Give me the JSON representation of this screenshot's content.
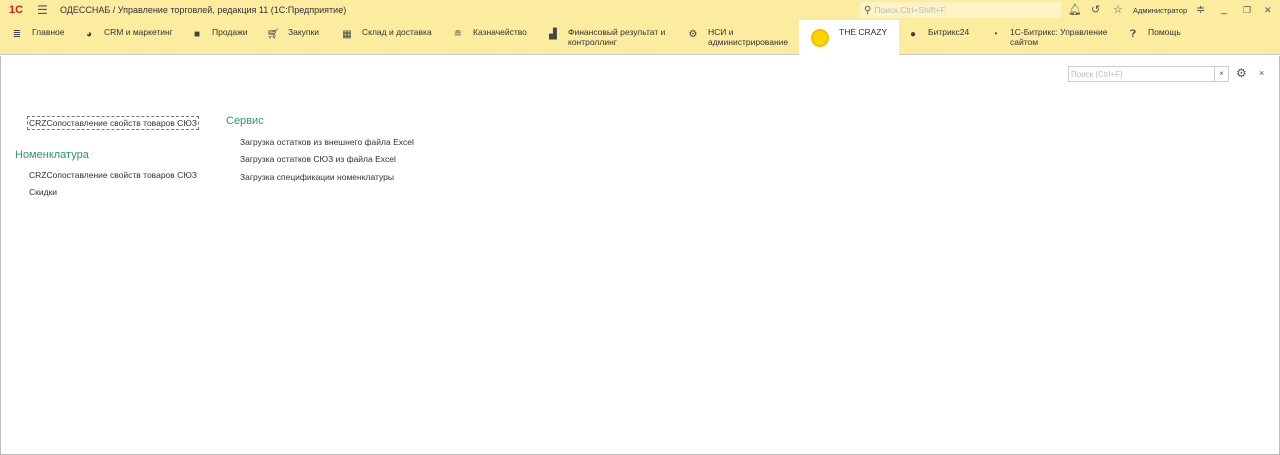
{
  "titlebar": {
    "logo": "1С",
    "title": "ОДЕССНАБ / Управление торговлей, редакция 11  (1С:Предприятие)",
    "search_placeholder": "Поиск Ctrl+Shift+F",
    "user": "Администратор"
  },
  "nav": [
    {
      "label": "Главное",
      "icon": "menu-icon"
    },
    {
      "label": "CRM и маркетинг",
      "icon": "pie-icon"
    },
    {
      "label": "Продажи",
      "icon": "bag-icon"
    },
    {
      "label": "Закупки",
      "icon": "cart-icon"
    },
    {
      "label": "Склад и доставка",
      "icon": "warehouse-icon"
    },
    {
      "label": "Казначейство",
      "icon": "coins-icon"
    },
    {
      "label": "Финансовый результат и контроллинг",
      "icon": "chart-icon"
    },
    {
      "label": "НСИ и администрирование",
      "icon": "gear-icon"
    },
    {
      "label": "THE CRAZY",
      "icon": "sun-icon",
      "active": true
    },
    {
      "label": "Битрикс24",
      "icon": "bitrix24-icon"
    },
    {
      "label": "1С-Битрикс: Управление сайтом",
      "icon": "bitrix-icon"
    },
    {
      "label": "Помощь",
      "icon": "help-icon"
    }
  ],
  "content": {
    "search_placeholder": "Поиск (Ctrl+F)",
    "top_link": "CRZСопоставление свойств товаров СЮЗ",
    "groups": [
      {
        "title": "Номенклатура",
        "items": [
          "CRZСопоставление свойств товаров СЮЗ",
          "Скидки"
        ]
      },
      {
        "title": "Сервис",
        "items": [
          "Загрузка остатков из внешнего файла Excel",
          "Загрузка остатков СЮЗ из файла Excel",
          "Загрузка спецификации номенклатуры"
        ]
      }
    ]
  }
}
